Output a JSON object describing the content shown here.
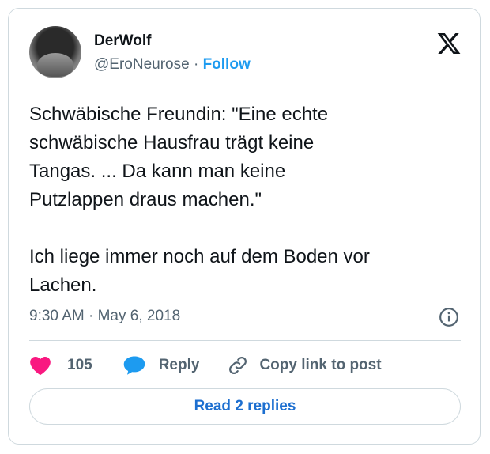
{
  "author": {
    "name": "DerWolf",
    "handle": "@EroNeurose",
    "separator": "·",
    "follow_label": "Follow"
  },
  "tweet": {
    "text": "Schwäbische Freundin: \"Eine echte\nschwäbische Hausfrau trägt keine\nTangas. ... Da kann man keine\nPutzlappen draus machen.\"\n\nIch liege immer noch auf dem Boden vor\nLachen.",
    "timestamp": "9:30 AM · May 6, 2018"
  },
  "actions": {
    "like_count": "105",
    "reply_label": "Reply",
    "copy_link_label": "Copy link to post"
  },
  "footer": {
    "read_replies_label": "Read 2 replies"
  },
  "icons": {
    "brand": "x-logo-icon",
    "like": "heart-icon",
    "reply": "speech-bubble-icon",
    "copy": "link-icon",
    "info": "info-icon"
  },
  "colors": {
    "like": "#f91880",
    "accent": "#1d9bf0",
    "link": "#1d6fd0",
    "muted": "#536471",
    "border": "#cfd9de"
  }
}
